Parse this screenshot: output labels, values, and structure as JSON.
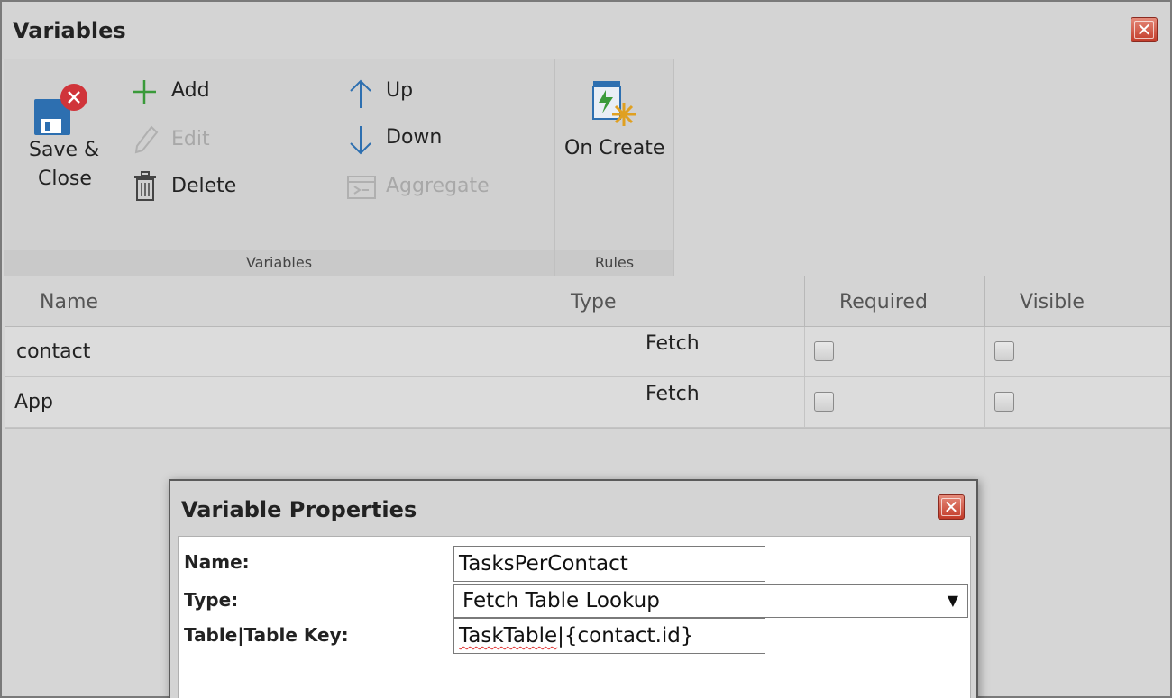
{
  "window": {
    "title": "Variables"
  },
  "ribbon": {
    "save_close": "Save &\nClose",
    "save_line1": "Save &",
    "save_line2": "Close",
    "add": "Add",
    "edit": "Edit",
    "delete": "Delete",
    "up": "Up",
    "down": "Down",
    "aggregate": "Aggregate",
    "on_create": "On Create",
    "group_variables": "Variables",
    "group_rules": "Rules"
  },
  "grid": {
    "columns": [
      "Name",
      "Type",
      "Required",
      "Visible"
    ],
    "rows": [
      {
        "name": "contact",
        "type": "Fetch",
        "required": false,
        "visible": false
      },
      {
        "name": "App",
        "type": "Fetch",
        "required": false,
        "visible": false
      }
    ]
  },
  "dialog": {
    "title": "Variable Properties",
    "name_label": "Name:",
    "name_value": "TasksPerContact",
    "type_label": "Type:",
    "type_value": "Fetch Table Lookup",
    "key_label": "Table|Table Key:",
    "key_value_part1": "TaskTable",
    "key_value_part2": "|{contact.id}"
  },
  "icons": {
    "accent_green": "#3a9a3a",
    "close_red": "#c23a28",
    "save_blue": "#2d6fb0"
  }
}
